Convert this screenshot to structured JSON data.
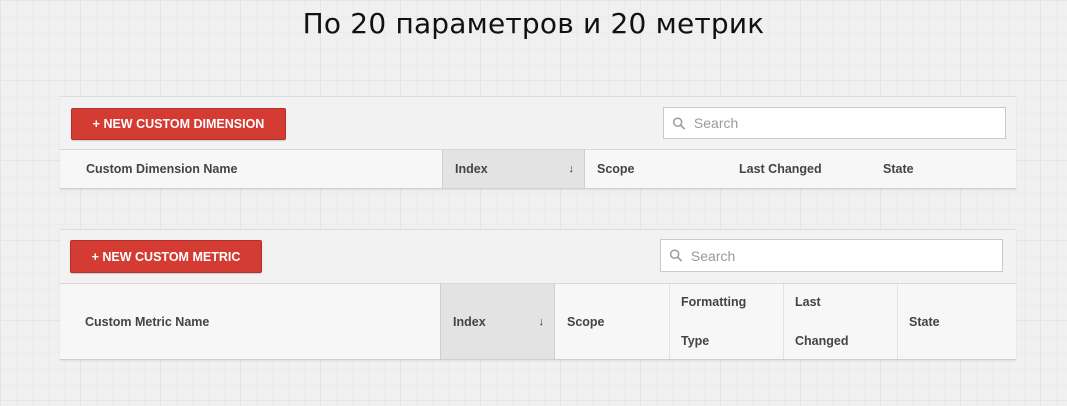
{
  "slide_title": "По 20 параметров и 20 метрик",
  "dimensions": {
    "new_button": "+ NEW CUSTOM DIMENSION",
    "search_placeholder": "Search",
    "columns": {
      "name": "Custom Dimension Name",
      "index": "Index",
      "scope": "Scope",
      "last_changed": "Last Changed",
      "state": "State"
    }
  },
  "metrics": {
    "new_button": "+ NEW CUSTOM METRIC",
    "search_placeholder": "Search",
    "columns": {
      "name": "Custom Metric Name",
      "index": "Index",
      "scope": "Scope",
      "formatting_type_1": "Formatting",
      "formatting_type_2": "Type",
      "last_changed_1": "Last",
      "last_changed_2": "Changed",
      "state": "State"
    }
  },
  "icons": {
    "search": "search-icon",
    "sort": "sort-down-arrow-icon"
  },
  "colors": {
    "button": "#d43b33",
    "sorted_column": "#e3e3e3"
  }
}
